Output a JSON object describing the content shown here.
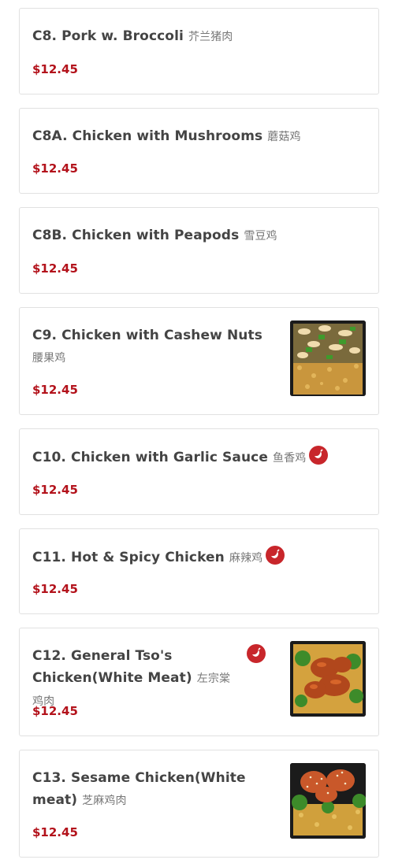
{
  "items": [
    {
      "title": "C8. Pork w. Broccoli",
      "cjk": "芥兰猪肉",
      "price": "$12.45"
    },
    {
      "title": "C8A. Chicken with Mushrooms",
      "cjk": "蘑菇鸡",
      "price": "$12.45"
    },
    {
      "title": "C8B. Chicken with Peapods",
      "cjk": "雪豆鸡",
      "price": "$12.45"
    },
    {
      "title": "C9. Chicken with Cashew Nuts",
      "cjk": "腰果鸡",
      "price": "$12.45"
    },
    {
      "title": "C10. Chicken with Garlic Sauce",
      "cjk": "鱼香鸡",
      "price": "$12.45"
    },
    {
      "title": "C11. Hot & Spicy Chicken",
      "cjk": "麻辣鸡",
      "price": "$12.45"
    },
    {
      "title_line1": "C12. General Tso's",
      "title_line2": "Chicken(White Meat)",
      "cjk": "左宗棠鸡肉",
      "price": "$12.45"
    },
    {
      "title_line1": "C13. Sesame Chicken(White",
      "title_line2": "meat)",
      "cjk": "芝麻鸡肉",
      "price": "$12.45"
    }
  ],
  "colors": {
    "price": "#b3121b",
    "spicy_badge": "#c8262b",
    "border": "#e1e1e1"
  },
  "icons": {
    "spicy": "chili-pepper-icon"
  }
}
